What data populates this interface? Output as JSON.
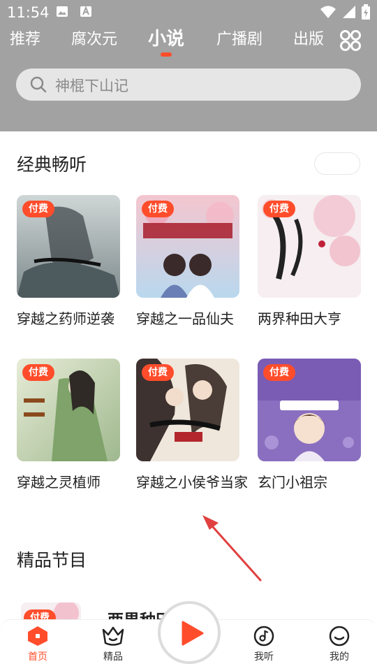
{
  "status_bar": {
    "time": "11:54",
    "icons": [
      "image-icon",
      "a-badge-icon",
      "wifi-icon",
      "signal-icon",
      "battery-icon"
    ]
  },
  "tabs": [
    {
      "label": "推荐",
      "active": false
    },
    {
      "label": "腐次元",
      "active": false
    },
    {
      "label": "小说",
      "active": true
    },
    {
      "label": "广播剧",
      "active": false
    },
    {
      "label": "出版",
      "active": false
    }
  ],
  "search": {
    "placeholder": "神棍下山记"
  },
  "sections": {
    "classic": {
      "title": "经典畅听"
    },
    "premium": {
      "title": "精品节目"
    }
  },
  "books": [
    {
      "title": "穿越之药师逆袭",
      "badge": "付费"
    },
    {
      "title": "穿越之一品仙夫",
      "badge": "付费"
    },
    {
      "title": "两界种田大亨",
      "badge": "付费"
    },
    {
      "title": "穿越之灵植师",
      "badge": "付费"
    },
    {
      "title": "穿越之小侯爷当家",
      "badge": "付费"
    },
    {
      "title": "玄门小祖宗",
      "badge": "付费"
    }
  ],
  "premium_peek": {
    "badge": "付费",
    "title": "两界种田"
  },
  "bottom_nav": [
    {
      "label": "首页",
      "icon": "home-icon",
      "active": true
    },
    {
      "label": "精品",
      "icon": "crown-icon",
      "active": false
    },
    {
      "label": "我听",
      "icon": "music-note-icon",
      "active": false
    },
    {
      "label": "我的",
      "icon": "smile-icon",
      "active": false
    }
  ],
  "colors": {
    "accent": "#ff4d2b",
    "header_bg": "#a2a2a2",
    "annotation_arrow": "#e04040"
  }
}
